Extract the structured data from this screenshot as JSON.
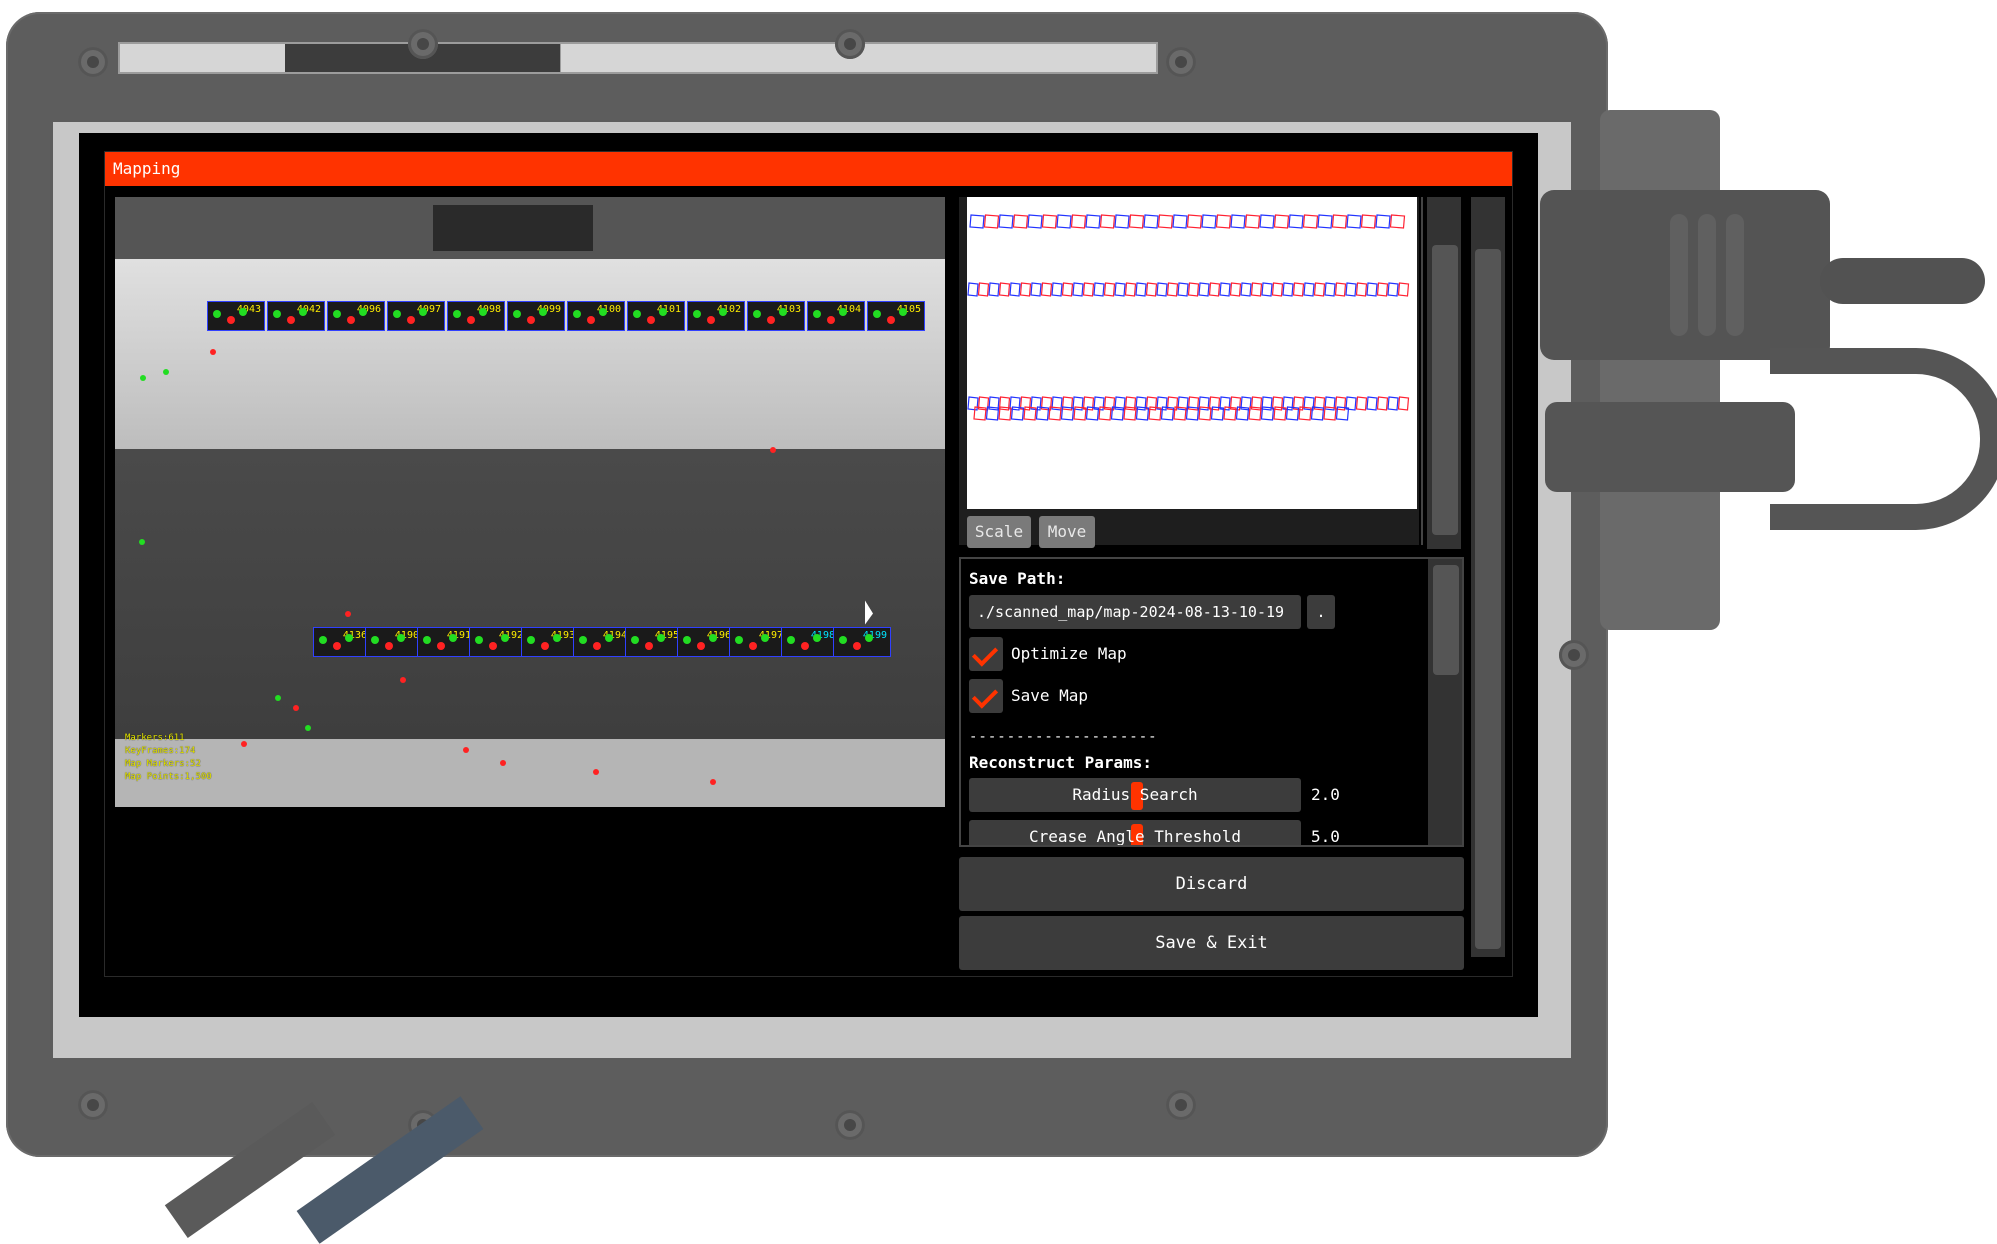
{
  "window": {
    "title": "Mapping"
  },
  "camera": {
    "tags_top": [
      "4043",
      "4042",
      "4096",
      "4097",
      "4098",
      "4099",
      "4100",
      "4101",
      "4102",
      "4103",
      "4104",
      "4105"
    ],
    "tags_bottom": [
      "4136",
      "4190",
      "4191",
      "4192",
      "4193",
      "4194",
      "4195",
      "4196",
      "4197",
      "4198",
      "4199"
    ],
    "stats": [
      "Markers:611",
      "KeyFrames:174",
      "Map Markers:52",
      "Map Points:1,500"
    ]
  },
  "map_preview": {
    "scale_label": "Scale",
    "move_label": "Move"
  },
  "settings": {
    "save_path_label": "Save Path:",
    "save_path_value": "./scanned_map/map-2024-08-13-10-19",
    "browse_label": ".",
    "optimize_map_label": "Optimize Map",
    "optimize_map_checked": true,
    "save_map_label": "Save Map",
    "save_map_checked": true,
    "divider": "--------------------",
    "reconstruct_label": "Reconstruct Params:",
    "radius_search_label": "Radius Search",
    "radius_search_value": "2.0",
    "crease_angle_label": "Crease Angle Threshold",
    "crease_angle_value": "5.0"
  },
  "actions": {
    "discard_label": "Discard",
    "save_exit_label": "Save & Exit"
  },
  "colors": {
    "accent": "#ff3300",
    "panel": "#3c3c3c",
    "background": "#000000"
  }
}
